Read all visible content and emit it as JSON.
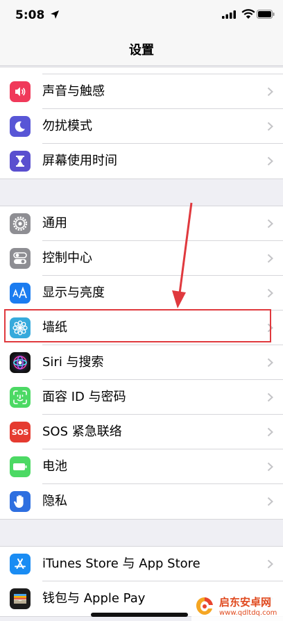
{
  "status_bar": {
    "time": "5:08"
  },
  "nav": {
    "title": "设置"
  },
  "sections": [
    {
      "items": [
        {
          "label": "声音与触感",
          "icon": "speaker-icon",
          "color": "#f0395a"
        },
        {
          "label": "勿扰模式",
          "icon": "moon-icon",
          "color": "#5856d6"
        },
        {
          "label": "屏幕使用时间",
          "icon": "hourglass-icon",
          "color": "#5a4fcf"
        }
      ]
    },
    {
      "items": [
        {
          "label": "通用",
          "icon": "gear-icon",
          "color": "#8e8e93"
        },
        {
          "label": "控制中心",
          "icon": "toggles-icon",
          "color": "#8e8e93"
        },
        {
          "label": "显示与亮度",
          "icon": "text-size-icon",
          "color": "#1b7cf0"
        },
        {
          "label": "墙纸",
          "icon": "flower-icon",
          "color": "#36aadc"
        },
        {
          "label": "Siri 与搜索",
          "icon": "siri-icon",
          "color": "#1a1a2e"
        },
        {
          "label": "面容 ID 与密码",
          "icon": "face-id-icon",
          "color": "#4cd964"
        },
        {
          "label": "SOS 紧急联络",
          "icon": "sos-icon",
          "color": "#e53b30",
          "icon_text": "SOS"
        },
        {
          "label": "电池",
          "icon": "battery-icon",
          "color": "#4cd964"
        },
        {
          "label": "隐私",
          "icon": "hand-icon",
          "color": "#2e6fe0"
        }
      ]
    },
    {
      "items": [
        {
          "label": "iTunes Store 与 App Store",
          "icon": "app-store-icon",
          "color": "#1a8cf3"
        },
        {
          "label": "钱包与 Apple Pay",
          "icon": "wallet-icon",
          "color": "#1c1c1c"
        }
      ]
    }
  ],
  "annotation": {
    "highlight_color": "#e0393e"
  },
  "watermark": {
    "title": "启东安卓网",
    "url": "www.qdltdq.com"
  }
}
